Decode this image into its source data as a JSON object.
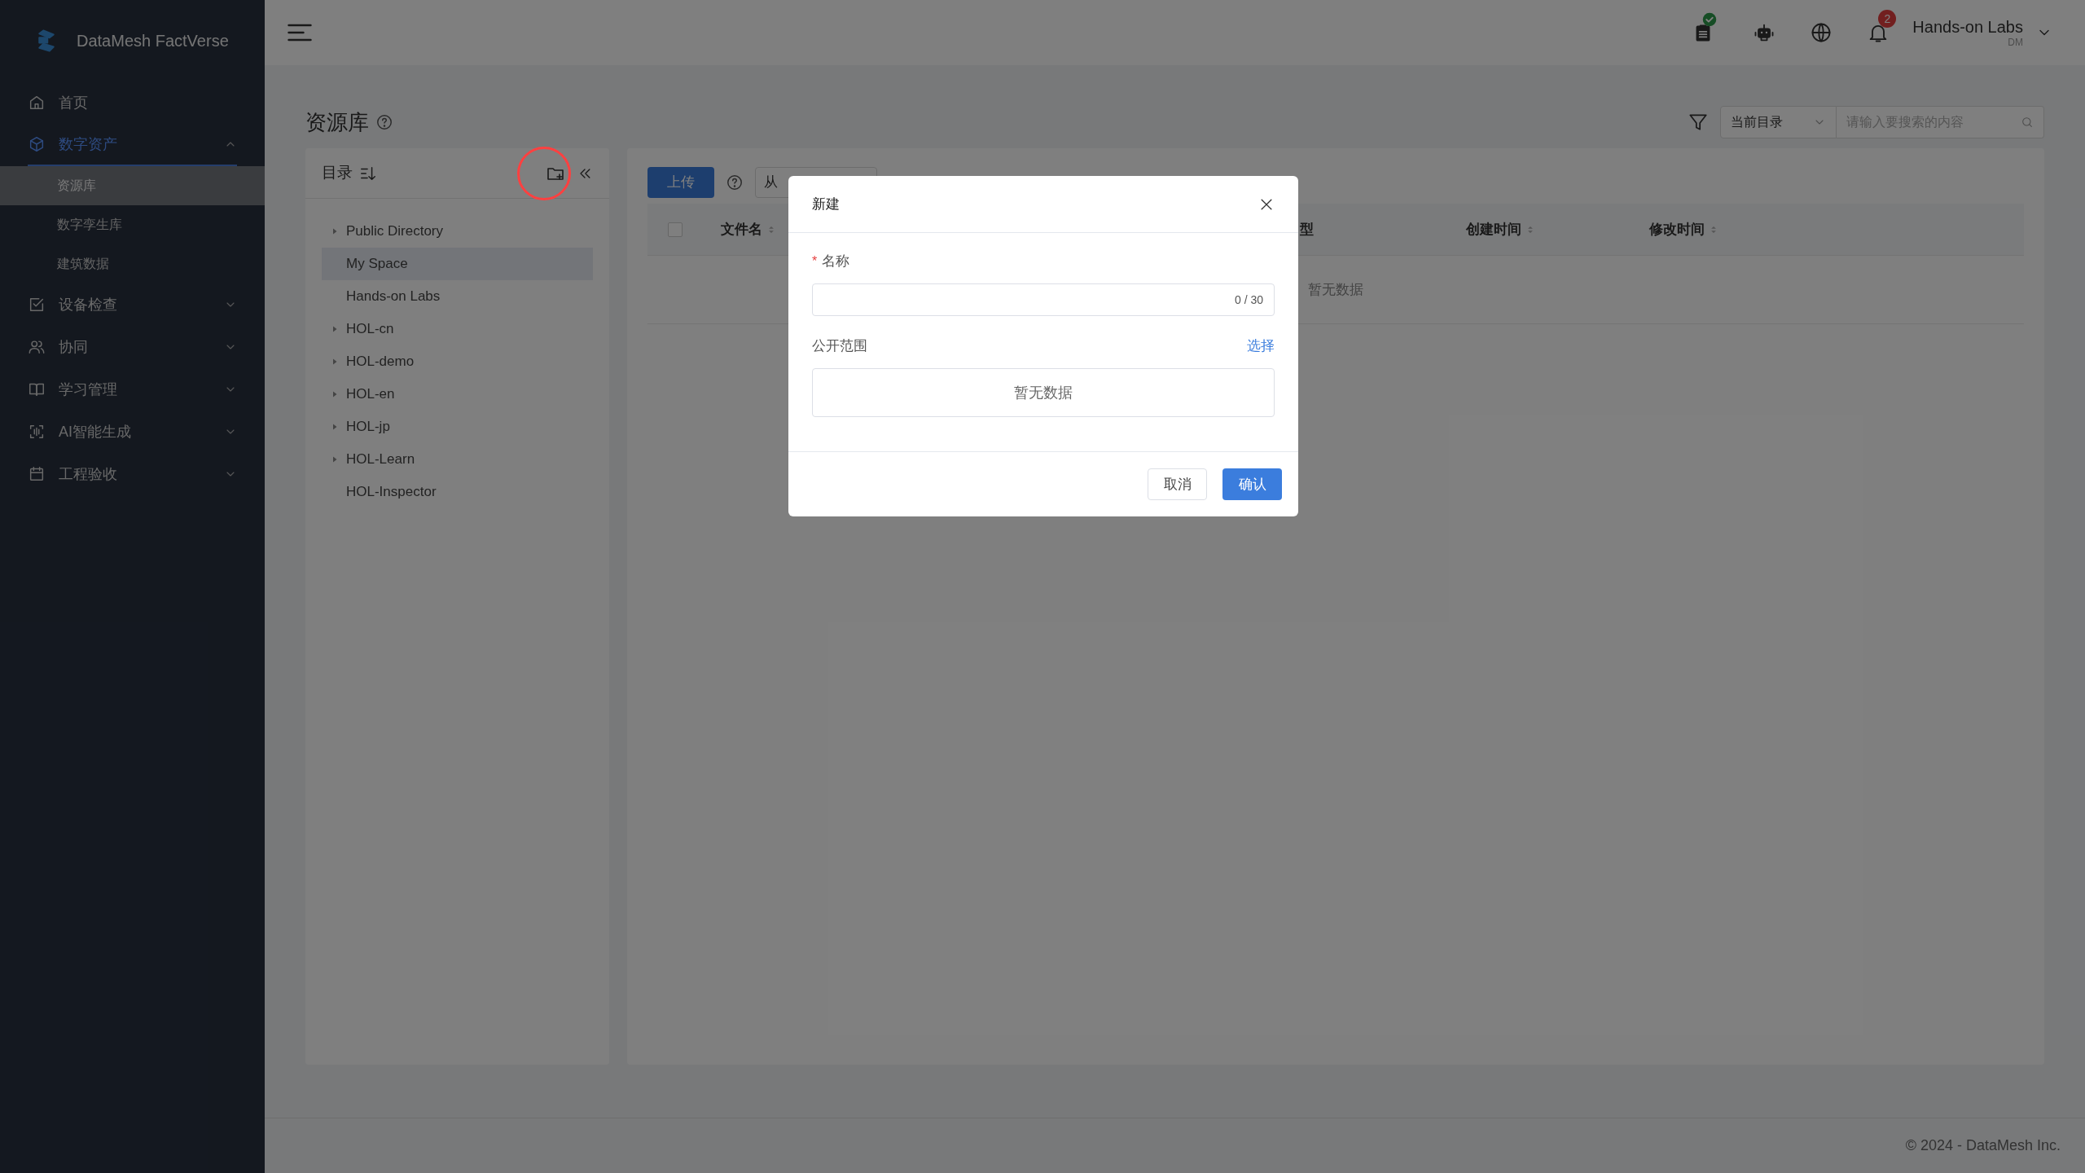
{
  "app": {
    "name": "DataMesh FactVerse"
  },
  "sidebar": {
    "items": [
      {
        "label": "首页",
        "selected": false
      },
      {
        "label": "数字资产",
        "selected": true,
        "expanded": true,
        "children": [
          {
            "label": "资源库",
            "selected": true
          },
          {
            "label": "数字孪生库",
            "selected": false
          },
          {
            "label": "建筑数据",
            "selected": false
          }
        ]
      },
      {
        "label": "设备检查",
        "selected": false,
        "expanded": false
      },
      {
        "label": "协同",
        "selected": false,
        "expanded": false
      },
      {
        "label": "学习管理",
        "selected": false,
        "expanded": false
      },
      {
        "label": "AI智能生成",
        "selected": false,
        "expanded": false
      },
      {
        "label": "工程验收",
        "selected": false,
        "expanded": false
      }
    ]
  },
  "topbar": {
    "notifications": "2",
    "user": {
      "name": "Hands-on Labs",
      "initials": "DM"
    }
  },
  "page": {
    "title": "资源库",
    "search": {
      "scope": "当前目录",
      "placeholder": "请输入要搜索的内容"
    }
  },
  "tree": {
    "title": "目录",
    "items": [
      {
        "label": "Public Directory",
        "expandable": true,
        "selected": false
      },
      {
        "label": "My Space",
        "expandable": false,
        "selected": true
      },
      {
        "label": "Hands-on Labs",
        "expandable": false,
        "selected": false
      },
      {
        "label": "HOL-cn",
        "expandable": true,
        "selected": false
      },
      {
        "label": "HOL-demo",
        "expandable": true,
        "selected": false
      },
      {
        "label": "HOL-en",
        "expandable": true,
        "selected": false
      },
      {
        "label": "HOL-jp",
        "expandable": true,
        "selected": false
      },
      {
        "label": "HOL-Learn",
        "expandable": true,
        "selected": false
      },
      {
        "label": "HOL-Inspector",
        "expandable": false,
        "selected": false
      }
    ]
  },
  "toolbar": {
    "upload": "上传",
    "import": "从"
  },
  "table": {
    "select_all": {
      "checked": false
    },
    "columns": [
      "文件名",
      "型",
      "创建时间",
      "修改时间"
    ],
    "empty": "暂无数据"
  },
  "modal": {
    "title": "新建",
    "name_label": "名称",
    "required_mark": "*",
    "counter": "0 / 30",
    "scope_label": "公开范围",
    "scope_link": "选择",
    "scope_empty": "暂无数据",
    "buttons": [
      "取消",
      "确认"
    ]
  },
  "footer": "© 2024 - DataMesh Inc."
}
